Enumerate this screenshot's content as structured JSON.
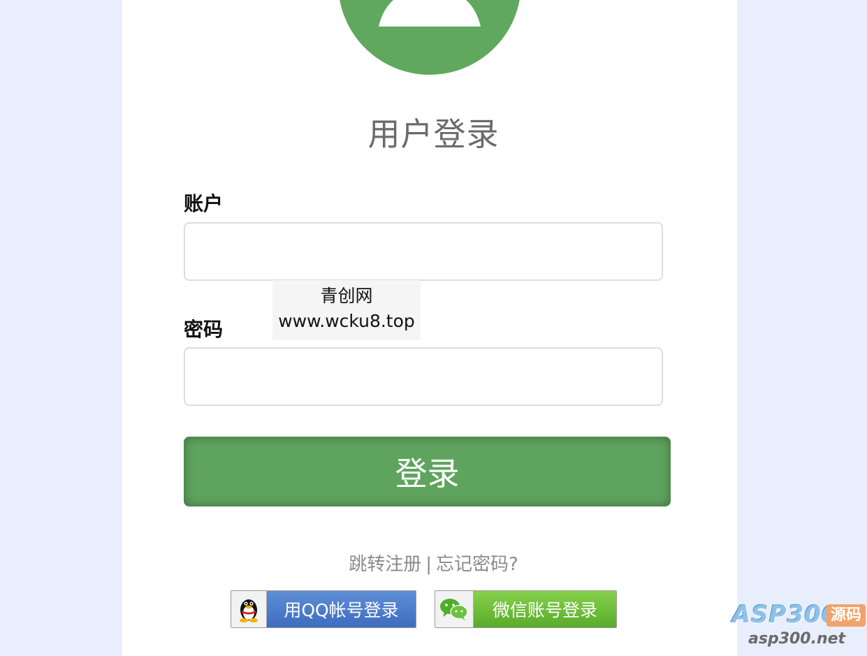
{
  "header": {
    "title": "用户登录"
  },
  "form": {
    "account_label": "账户",
    "account_value": "",
    "password_label": "密码",
    "password_value": "",
    "submit_label": "登录"
  },
  "watermark": {
    "line1": "青创网",
    "line2": "www.wcku8.top"
  },
  "links": {
    "register": "跳转注册",
    "separator": "|",
    "forgot": "忘记密码?"
  },
  "social": {
    "qq_label": "用QQ帐号登录",
    "wechat_label": "微信账号登录"
  },
  "brand": {
    "name": "ASP300",
    "tag": "源码",
    "url": "asp300.net"
  },
  "colors": {
    "accent_green": "#5fa45e",
    "page_background": "#e8eefc",
    "qq_blue": "#3e6cbf",
    "wechat_green": "#5aab2a"
  },
  "icons": {
    "avatar": "user-avatar-icon",
    "qq": "qq-penguin-icon",
    "wechat": "wechat-icon"
  }
}
